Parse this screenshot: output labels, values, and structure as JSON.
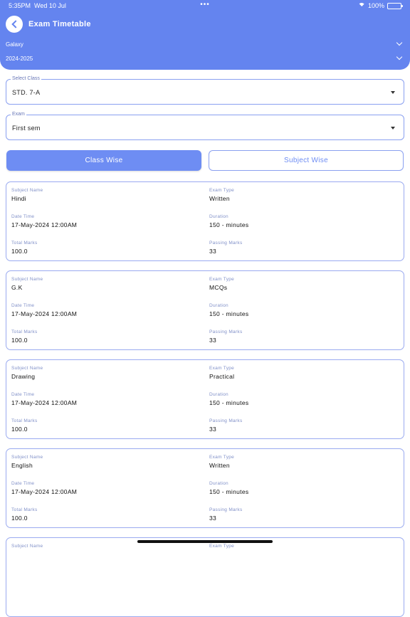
{
  "status": {
    "time": "5:35PM",
    "date": "Wed 10 Jul",
    "dots": "•••",
    "battery": "100%"
  },
  "header": {
    "title": "Exam Timetable",
    "school": "Galaxy",
    "year": "2024-2025"
  },
  "select_class": {
    "label": "Select Class",
    "value": "STD. 7-A"
  },
  "exam": {
    "label": "Exam",
    "value": "First sem"
  },
  "tabs": {
    "class_wise": "Class Wise",
    "subject_wise": "Subject Wise"
  },
  "labels": {
    "subject": "Subject Name",
    "exam_type": "Exam Type",
    "date_time": "Date Time",
    "duration": "Duration",
    "total_marks": "Total Marks",
    "passing_marks": "Passing Marks"
  },
  "exams": [
    {
      "subject": "Hindi",
      "type": "Written",
      "datetime": "17-May-2024 12:00AM",
      "duration": "150 - minutes",
      "total": "100.0",
      "passing": "33"
    },
    {
      "subject": "G.K",
      "type": "MCQs",
      "datetime": "17-May-2024 12:00AM",
      "duration": "150 - minutes",
      "total": "100.0",
      "passing": "33"
    },
    {
      "subject": "Drawing",
      "type": "Practical",
      "datetime": "17-May-2024 12:00AM",
      "duration": "150 - minutes",
      "total": "100.0",
      "passing": "33"
    },
    {
      "subject": "English",
      "type": "Written",
      "datetime": "17-May-2024 12:00AM",
      "duration": "150 - minutes",
      "total": "100.0",
      "passing": "33"
    }
  ]
}
